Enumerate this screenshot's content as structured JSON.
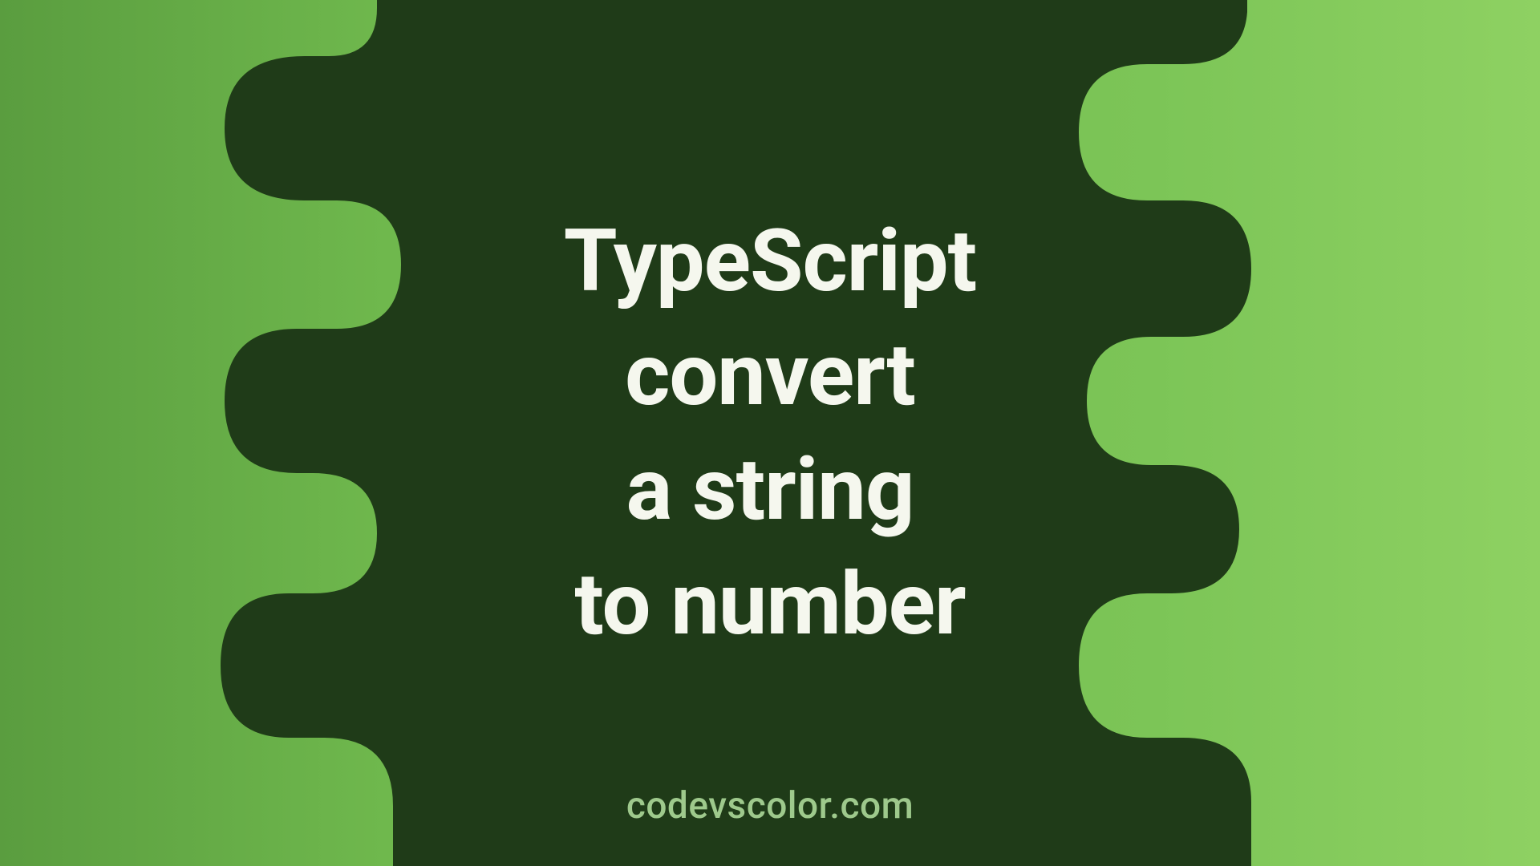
{
  "title": {
    "line1": "TypeScript",
    "line2": "convert",
    "line3": "a string",
    "line4": "to number"
  },
  "footer": {
    "site": "codevscolor.com"
  },
  "colors": {
    "blob": "#1f3b18",
    "text": "#f5f7ee",
    "siteText": "#9ec98c",
    "bgLeft": "#5a9d3f",
    "bgRight": "#8ed162"
  }
}
